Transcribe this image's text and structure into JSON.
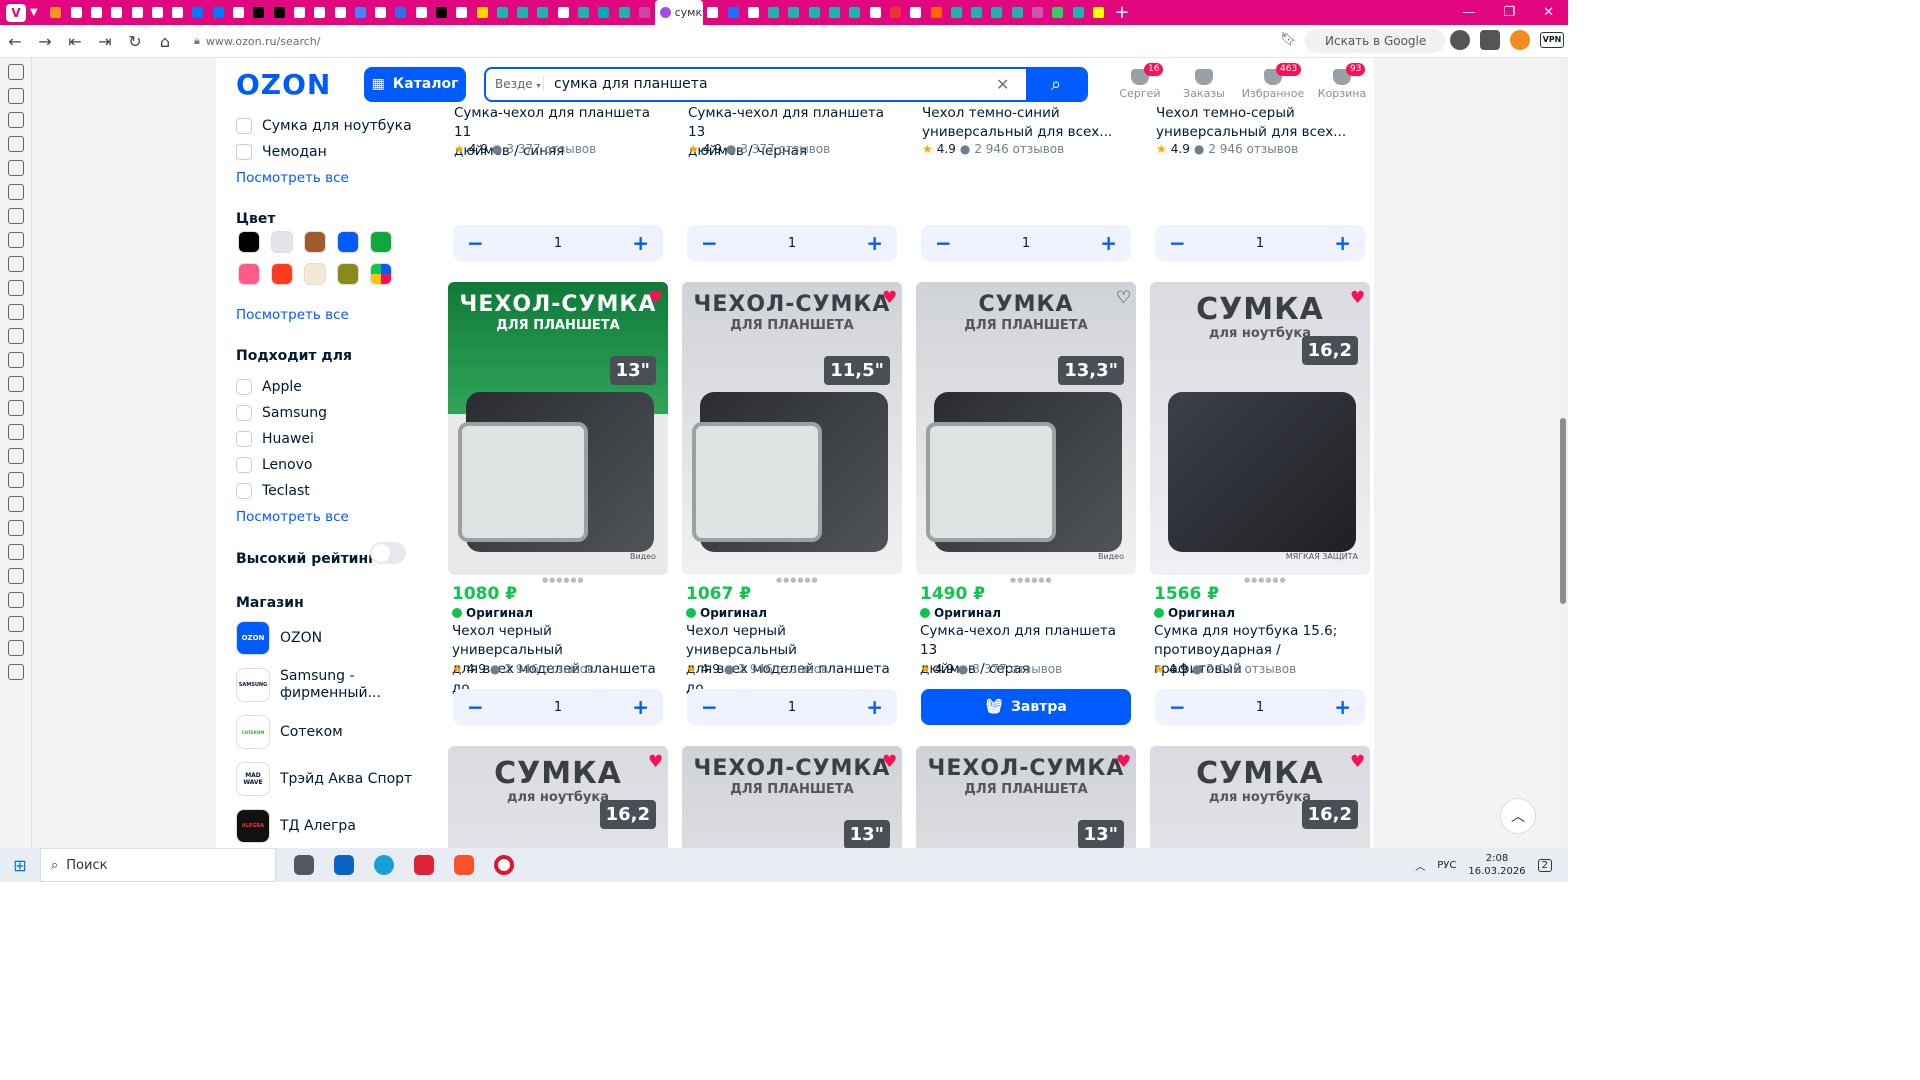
{
  "browser": {
    "active_tab_title": "сумк",
    "url": "www.ozon.ru/search/",
    "google_placeholder": "Искать в Google",
    "vpn": "VPN"
  },
  "header": {
    "logo": "OZON",
    "catalog": "Каталог",
    "scope": "Везде",
    "query": "сумка для планшета",
    "icons": [
      {
        "label": "Сергей",
        "badge": "16"
      },
      {
        "label": "Заказы",
        "badge": ""
      },
      {
        "label": "Избранное",
        "badge": "463"
      },
      {
        "label": "Корзина",
        "badge": "93"
      }
    ]
  },
  "filters": {
    "type_items": [
      "Сумка для ноутбука",
      "Чемодан"
    ],
    "see_all": "Посмотреть все",
    "color_title": "Цвет",
    "colors": [
      "#000000",
      "#e3e5ea",
      "#a05a2c",
      "#005bff",
      "#10a83d",
      "#ff5a8a",
      "#ff3b1f",
      "#f5e9d3",
      "#8a8a1a",
      "multi"
    ],
    "fits_title": "Подходит для",
    "fits": [
      "Apple",
      "Samsung",
      "Huawei",
      "Lenovo",
      "Teclast"
    ],
    "rating_title": "Высокий рейтинг",
    "shop_title": "Магазин",
    "shops": [
      {
        "name": "OZON",
        "logo": "OZON"
      },
      {
        "name": "Samsung - фирменный...",
        "logo": "SAMSUNG"
      },
      {
        "name": "Сотеком",
        "logo": "СОТЕКОМ"
      },
      {
        "name": "Трэйд Аква Спорт",
        "logo": "MAD WAVE"
      },
      {
        "name": "ТД Алегра",
        "logo": "ALEGRA"
      }
    ]
  },
  "top_row": [
    {
      "title1": "Сумка-чехол для планшета 11",
      "title2": "дюймов / синяя",
      "rating": "4.9",
      "reviews": "3 377 отзывов",
      "qty": "1"
    },
    {
      "title1": "Сумка-чехол для планшета 13",
      "title2": "дюймов / черная",
      "rating": "4.9",
      "reviews": "3 377 отзывов",
      "qty": "1"
    },
    {
      "title1": "Чехол темно-синий",
      "title2": "универсальный для всех...",
      "rating": "4.9",
      "reviews": "2 946 отзывов",
      "qty": "1"
    },
    {
      "title1": "Чехол темно-серый",
      "title2": "универсальный для всех...",
      "rating": "4.9",
      "reviews": "2 946 отзывов",
      "qty": "1"
    }
  ],
  "products": [
    {
      "img_head": "ЧЕХОЛ-СУМКА",
      "img_sub": "ДЛЯ ПЛАНШЕТА",
      "img_size": "13\"",
      "img_note": "Видео",
      "price": "1080 ₽",
      "badge": "Оригинал",
      "title1": "Чехол черный универсальный",
      "title2": "для всех моделей планшета до...",
      "rating": "4.9",
      "reviews": "2 946 отзывов",
      "qty": "1"
    },
    {
      "img_head": "ЧЕХОЛ-СУМКА",
      "img_sub": "ДЛЯ ПЛАНШЕТА",
      "img_size": "11,5\"",
      "img_note": "",
      "price": "1067 ₽",
      "badge": "Оригинал",
      "title1": "Чехол черный универсальный",
      "title2": "для всех моделей планшета до...",
      "rating": "4.9",
      "reviews": "2 946 отзывов",
      "qty": "1"
    },
    {
      "img_head": "СУМКА",
      "img_sub": "ДЛЯ ПЛАНШЕТА",
      "img_size": "13,3\"",
      "img_note": "Видео",
      "price": "1490 ₽",
      "badge": "Оригинал",
      "title1": "Сумка-чехол для планшета 13",
      "title2": "дюймов / серая",
      "rating": "4.9",
      "reviews": "3 377 отзывов",
      "deliver": "Завтра"
    },
    {
      "img_head": "СУМКА",
      "img_sub": "для ноутбука",
      "img_size": "16,2",
      "img_note": "МЯГКАЯ ЗАЩИТА",
      "price": "1566 ₽",
      "badge": "Оригинал",
      "title1": "Сумка для ноутбука 15.6;",
      "title2": "противоударная / графитовый",
      "rating": "4.9",
      "reviews": "2 048 отзывов",
      "qty": "1"
    }
  ],
  "bottom_row": [
    {
      "img_head": "СУМКА",
      "img_sub": "для ноутбука",
      "img_size": "16,2"
    },
    {
      "img_head": "ЧЕХОЛ-СУМКА",
      "img_sub": "ДЛЯ ПЛАНШЕТА",
      "img_size": "13\""
    },
    {
      "img_head": "ЧЕХОЛ-СУМКА",
      "img_sub": "ДЛЯ ПЛАНШЕТА",
      "img_size": "13\""
    },
    {
      "img_head": "СУМКА",
      "img_sub": "для ноутбука",
      "img_size": "16,2"
    }
  ],
  "taskbar": {
    "search": "Поиск",
    "lang": "РУС",
    "time": "2:08",
    "date": "16.03.2026",
    "notif": "2"
  }
}
